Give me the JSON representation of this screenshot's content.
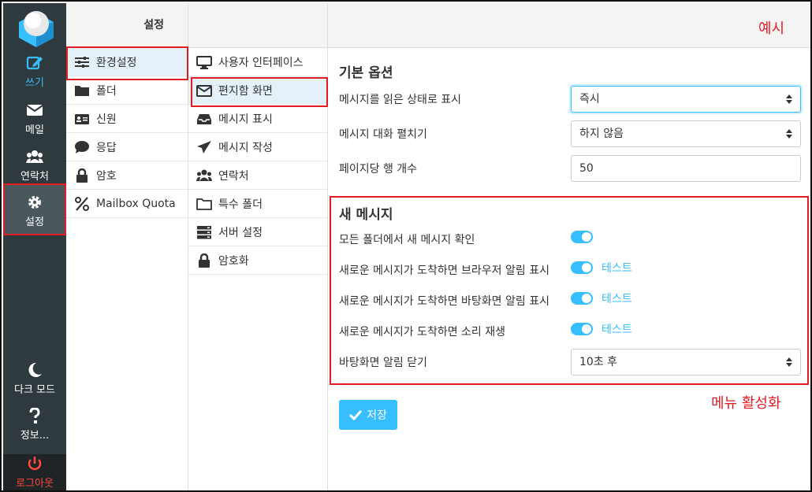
{
  "rail": {
    "compose": "쓰기",
    "mail": "메일",
    "contacts": "연락처",
    "settings": "설정",
    "dark_mode": "다크 모드",
    "about": "정보...",
    "logout": "로그아웃"
  },
  "settings_col": {
    "header": "설정",
    "items": [
      {
        "label": "환경설정",
        "icon": "sliders-icon"
      },
      {
        "label": "폴더",
        "icon": "folder-icon"
      },
      {
        "label": "신원",
        "icon": "id-card-icon"
      },
      {
        "label": "응답",
        "icon": "comment-icon"
      },
      {
        "label": "암호",
        "icon": "lock-icon"
      },
      {
        "label": "Mailbox Quota",
        "icon": "percent-icon"
      }
    ]
  },
  "prefs_col": {
    "items": [
      {
        "label": "사용자 인터페이스",
        "icon": "monitor-icon"
      },
      {
        "label": "편지함 화면",
        "icon": "envelope-icon"
      },
      {
        "label": "메시지 표시",
        "icon": "inbox-icon"
      },
      {
        "label": "메시지 작성",
        "icon": "paper-plane-icon"
      },
      {
        "label": "연락처",
        "icon": "users-icon"
      },
      {
        "label": "특수 폴더",
        "icon": "folder-outline-icon"
      },
      {
        "label": "서버 설정",
        "icon": "server-icon"
      },
      {
        "label": "암호화",
        "icon": "lock-icon"
      }
    ]
  },
  "main": {
    "annotation_example": "예시",
    "annotation_menu": "메뉴 활성화",
    "basic": {
      "title": "기본 옵션",
      "mark_read_label": "메시지를 읽은 상태로 표시",
      "mark_read_value": "즉시",
      "expand_label": "메시지 대화 펼치기",
      "expand_value": "하지 않음",
      "rows_label": "페이지당 행 개수",
      "rows_value": "50"
    },
    "new_msg": {
      "title": "새 메시지",
      "check_all_label": "모든 폴더에서 새 메시지 확인",
      "browser_notify_label": "새로운 메시지가 도착하면 브라우저 알림 표시",
      "desktop_notify_label": "새로운 메시지가 도착하면 바탕화면 알림 표시",
      "sound_label": "새로운 메시지가 도착하면 소리 재생",
      "test_label": "테스트",
      "close_label": "바탕화면 알림 닫기",
      "close_value": "10초 후"
    },
    "save_label": "저장"
  },
  "colors": {
    "accent": "#37beff",
    "annotation": "#e31b23",
    "rail": "#2f3a3f"
  }
}
